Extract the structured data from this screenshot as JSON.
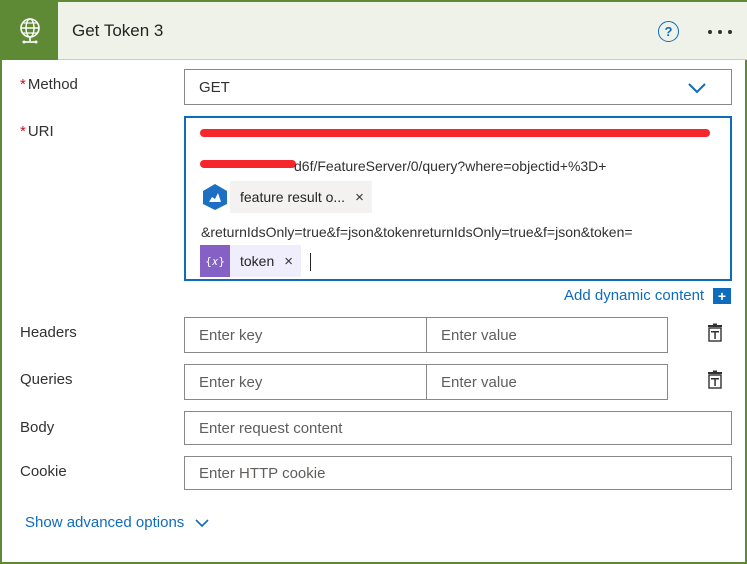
{
  "header": {
    "title": "Get Token 3",
    "help_symbol": "?",
    "icon": "globe-icon",
    "more_icon": "more-options-icon",
    "accent_color": "#5f8a35"
  },
  "method": {
    "label": "Method",
    "required_mark": "*",
    "value": "GET",
    "dropdown_icon": "chevron-down-icon"
  },
  "uri": {
    "label": "URI",
    "required_mark": "*",
    "line2_text": "d6f/FeatureServer/0/query?where=objectid+%3D+",
    "chip1": {
      "label": "feature result o...",
      "icon": "arcgis-icon",
      "remove": "×"
    },
    "line4_text": "&returnIdsOnly=true&f=json&tokenreturnIdsOnly=true&f=json&token=",
    "chip2": {
      "label": "token",
      "icon": "expression-icon",
      "remove": "×"
    }
  },
  "dynamic": {
    "label": "Add dynamic content",
    "plus": "+"
  },
  "headers": {
    "label": "Headers",
    "key_placeholder": "Enter key",
    "value_placeholder": "Enter value",
    "delete_icon": "delete-icon"
  },
  "queries": {
    "label": "Queries",
    "key_placeholder": "Enter key",
    "value_placeholder": "Enter value",
    "delete_icon": "delete-icon"
  },
  "body": {
    "label": "Body",
    "placeholder": "Enter request content"
  },
  "cookie": {
    "label": "Cookie",
    "placeholder": "Enter HTTP cookie"
  },
  "advanced": {
    "label": "Show advanced options"
  }
}
